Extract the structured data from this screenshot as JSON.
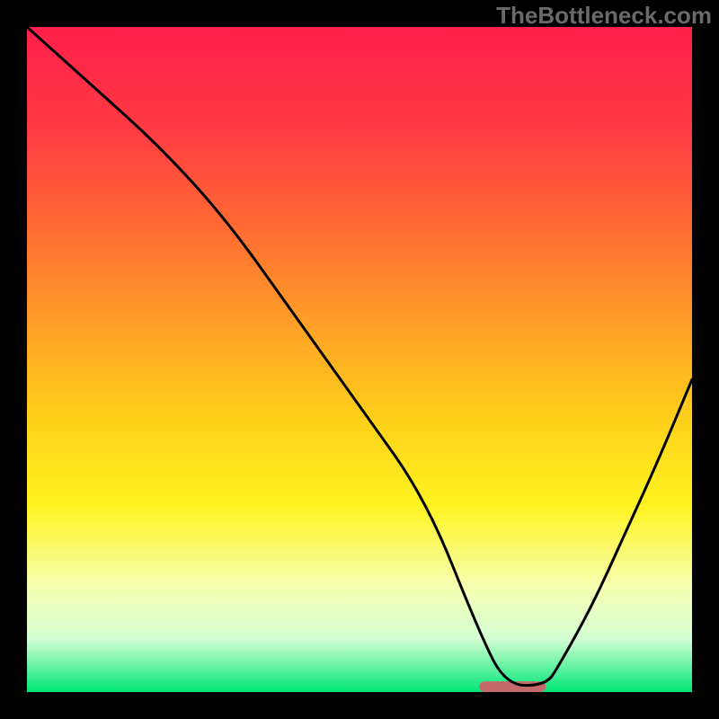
{
  "watermark": "TheBottleneck.com",
  "chart_data": {
    "type": "line",
    "title": "",
    "xlabel": "",
    "ylabel": "",
    "xlim": [
      0,
      100
    ],
    "ylim": [
      0,
      100
    ],
    "grid": false,
    "legend": false,
    "series": [
      {
        "name": "curve",
        "x": [
          0,
          10,
          20,
          30,
          40,
          50,
          60,
          68,
          72,
          78,
          80,
          85,
          90,
          95,
          100
        ],
        "y": [
          100,
          91,
          82,
          71,
          57,
          43,
          29,
          9,
          1,
          1,
          4,
          13,
          24,
          35,
          47
        ]
      }
    ],
    "optimal_marker": {
      "x_start": 68,
      "x_end": 78,
      "y": 0.8,
      "color": "#c46a6a",
      "height": 1.6
    },
    "gradient_stops": [
      {
        "offset": 0.0,
        "color": "#ff1f4b"
      },
      {
        "offset": 0.15,
        "color": "#ff3a43"
      },
      {
        "offset": 0.3,
        "color": "#ff6a33"
      },
      {
        "offset": 0.45,
        "color": "#ffa126"
      },
      {
        "offset": 0.6,
        "color": "#ffd31a"
      },
      {
        "offset": 0.72,
        "color": "#fff321"
      },
      {
        "offset": 0.84,
        "color": "#f6ffb0"
      },
      {
        "offset": 0.92,
        "color": "#d4ffd4"
      },
      {
        "offset": 1.0,
        "color": "#00e676"
      }
    ]
  }
}
